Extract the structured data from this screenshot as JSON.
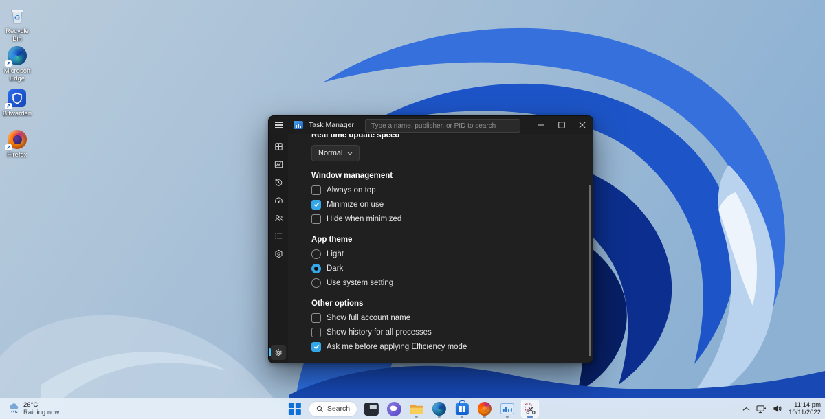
{
  "colors": {
    "accent_blue": "#35a7e8",
    "selected_pill": "#4cc2ff",
    "window_bg": "#202020",
    "sidebar_bg": "#1c1c1c",
    "taskbar_bg": "#e3edf7"
  },
  "desktop": {
    "icons": [
      {
        "name": "recycle-bin",
        "label": "Recycle Bin"
      },
      {
        "name": "microsoft-edge",
        "label": "Microsoft Edge"
      },
      {
        "name": "bitwarden",
        "label": "Bitwarden"
      },
      {
        "name": "firefox",
        "label": "Firefox"
      }
    ]
  },
  "window": {
    "title": "Task Manager",
    "search_placeholder": "Type a name, publisher, or PID to search",
    "sidebar_items": [
      "processes",
      "performance",
      "app-history",
      "startup-apps",
      "users",
      "details",
      "services"
    ],
    "sidebar_selected": "settings"
  },
  "settings": {
    "update_speed": {
      "label": "Real time update speed",
      "value": "Normal"
    },
    "window_management": {
      "title": "Window management",
      "items": [
        {
          "label": "Always on top",
          "checked": false
        },
        {
          "label": "Minimize on use",
          "checked": true
        },
        {
          "label": "Hide when minimized",
          "checked": false
        }
      ]
    },
    "app_theme": {
      "title": "App theme",
      "options": [
        {
          "label": "Light",
          "selected": false
        },
        {
          "label": "Dark",
          "selected": true
        },
        {
          "label": "Use system setting",
          "selected": false
        }
      ]
    },
    "other_options": {
      "title": "Other options",
      "items": [
        {
          "label": "Show full account name",
          "checked": false
        },
        {
          "label": "Show history for all processes",
          "checked": false
        },
        {
          "label": "Ask me before applying Efficiency mode",
          "checked": true
        }
      ]
    }
  },
  "taskbar": {
    "search_label": "Search",
    "weather": {
      "temp": "26°C",
      "status": "Raining now"
    },
    "apps": [
      "start",
      "search",
      "monitor-app",
      "chat",
      "file-explorer",
      "edge",
      "microsoft-store",
      "firefox",
      "task-manager",
      "snipping-tool"
    ],
    "running_apps": [
      "file-explorer",
      "edge",
      "microsoft-store",
      "firefox",
      "task-manager"
    ],
    "active_app": "snipping-tool",
    "clock": {
      "time": "11:14 pm",
      "date": "10/11/2022"
    }
  }
}
